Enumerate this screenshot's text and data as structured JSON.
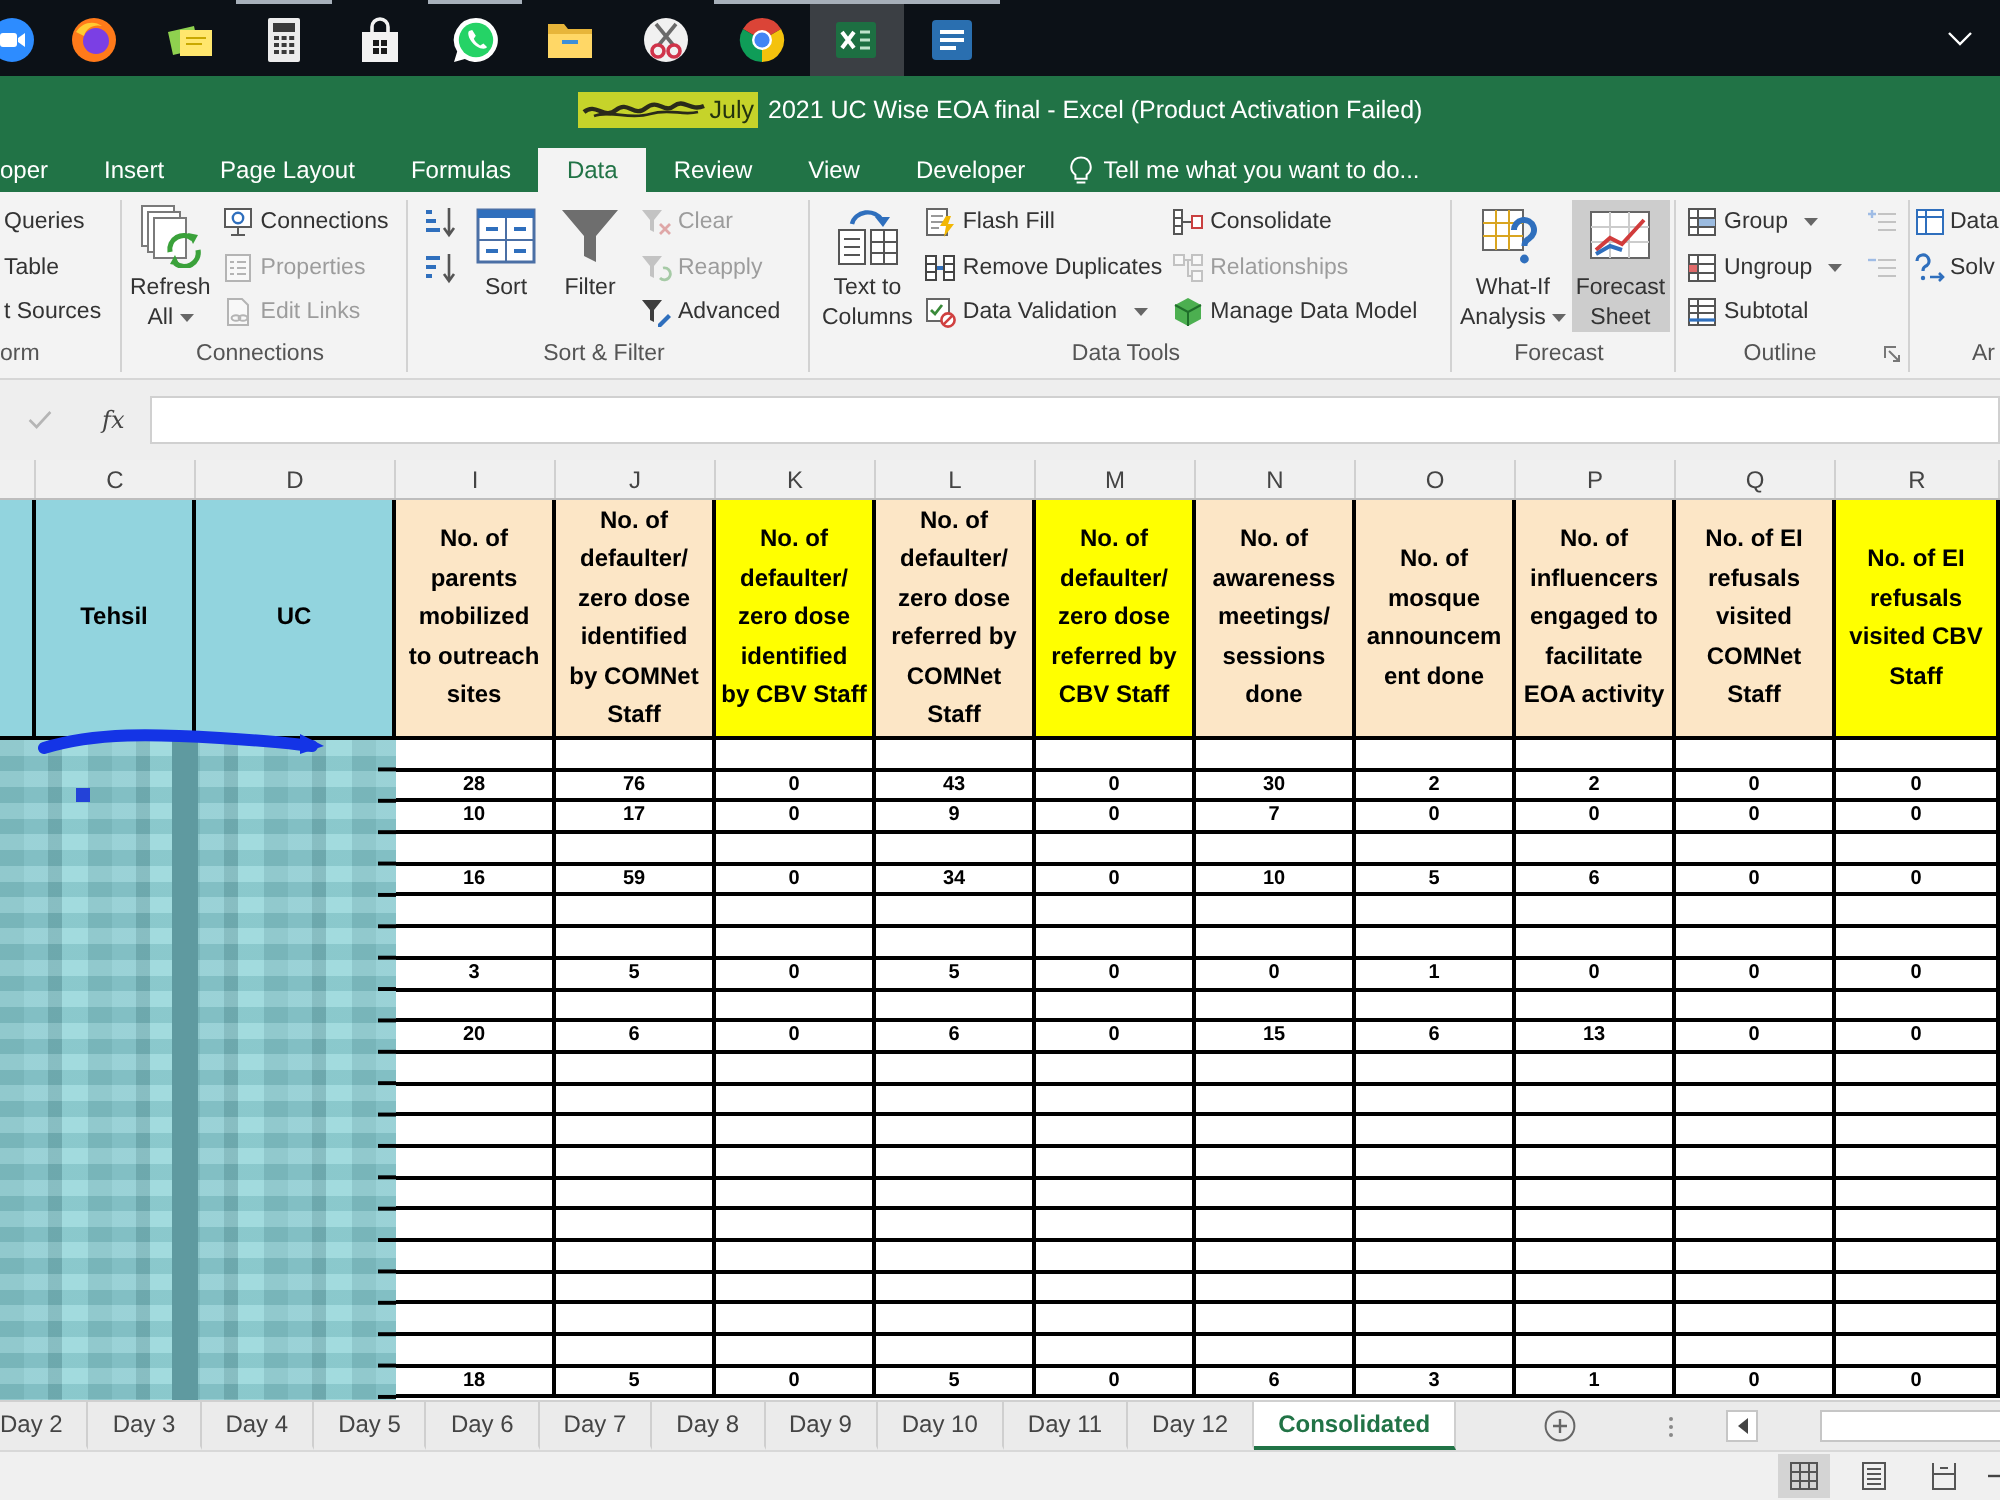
{
  "taskbar": {
    "items": [
      {
        "kind": "video",
        "selected": false,
        "running": false
      },
      {
        "kind": "globe",
        "selected": false,
        "running": false
      },
      {
        "kind": "notes",
        "selected": false,
        "running": false
      },
      {
        "kind": "calculator",
        "selected": false,
        "running": true
      },
      {
        "kind": "store",
        "selected": false,
        "running": false
      },
      {
        "kind": "chat",
        "selected": false,
        "running": true
      },
      {
        "kind": "folder",
        "selected": false,
        "running": false
      },
      {
        "kind": "scissors",
        "selected": false,
        "running": false
      },
      {
        "kind": "browser",
        "selected": false,
        "running": true
      },
      {
        "kind": "spreadsheet",
        "selected": true,
        "running": true
      },
      {
        "kind": "slides",
        "selected": false,
        "running": true
      }
    ]
  },
  "window": {
    "title": {
      "highlighted": "July",
      "text": "2021 UC Wise EOA final - Excel (Product Activation Failed)"
    }
  },
  "ribbon_tabs": [
    {
      "label": "oper",
      "selected": false
    },
    {
      "label": "Insert",
      "selected": false
    },
    {
      "label": "Page Layout",
      "selected": false
    },
    {
      "label": "Formulas",
      "selected": false
    },
    {
      "label": "Data",
      "selected": true
    },
    {
      "label": "Review",
      "selected": false
    },
    {
      "label": "View",
      "selected": false
    },
    {
      "label": "Developer",
      "selected": false
    }
  ],
  "tell_me": {
    "placeholder": "Tell me what you want to do..."
  },
  "ribbon": {
    "groups": [
      {
        "label": "orm",
        "launcher": false,
        "items": [
          {
            "kind": "stack",
            "buttons": [
              {
                "label": "Queries",
                "disabled": false,
                "dropdown": false
              },
              {
                "label": "Table",
                "disabled": false,
                "dropdown": false
              },
              {
                "label": "t Sources",
                "disabled": false,
                "dropdown": false
              }
            ]
          }
        ]
      },
      {
        "label": "Connections",
        "launcher": false,
        "items": [
          {
            "kind": "large",
            "label": "Refresh All",
            "disabled": false,
            "dropdown": true,
            "hovered": false
          },
          {
            "kind": "stack",
            "buttons": [
              {
                "label": "Connections",
                "disabled": false,
                "dropdown": false
              },
              {
                "label": "Properties",
                "disabled": true,
                "dropdown": false
              },
              {
                "label": "Edit Links",
                "disabled": true,
                "dropdown": false
              }
            ]
          }
        ]
      },
      {
        "label": "Sort & Filter",
        "launcher": false,
        "items": [
          {
            "kind": "stack",
            "buttons": [
              {
                "disabled": false,
                "dropdown": false
              },
              {
                "disabled": false,
                "dropdown": false
              }
            ]
          },
          {
            "kind": "large",
            "label": "Sort",
            "disabled": false,
            "dropdown": false,
            "hovered": false
          },
          {
            "kind": "large",
            "label": "Filter",
            "disabled": false,
            "dropdown": false,
            "hovered": false
          },
          {
            "kind": "stack",
            "buttons": [
              {
                "label": "Clear",
                "disabled": true,
                "dropdown": false
              },
              {
                "label": "Reapply",
                "disabled": true,
                "dropdown": false
              },
              {
                "label": "Advanced",
                "disabled": false,
                "dropdown": false
              }
            ]
          }
        ]
      },
      {
        "label": "Data Tools",
        "launcher": false,
        "items": [
          {
            "kind": "large",
            "label": "Text to Columns",
            "disabled": false,
            "dropdown": false,
            "hovered": false
          },
          {
            "kind": "stack",
            "buttons": [
              {
                "label": "Flash Fill",
                "disabled": false,
                "dropdown": false
              },
              {
                "label": "Remove Duplicates",
                "disabled": false,
                "dropdown": false
              },
              {
                "label": "Data Validation",
                "disabled": false,
                "dropdown": true
              }
            ]
          },
          {
            "kind": "stack",
            "buttons": [
              {
                "label": "Consolidate",
                "disabled": false,
                "dropdown": false
              },
              {
                "label": "Relationships",
                "disabled": true,
                "dropdown": false
              },
              {
                "label": "Manage Data Model",
                "disabled": false,
                "dropdown": false
              }
            ]
          }
        ]
      },
      {
        "label": "Forecast",
        "launcher": false,
        "items": [
          {
            "kind": "large",
            "label": "What-If Analysis",
            "disabled": false,
            "dropdown": true,
            "hovered": false
          },
          {
            "kind": "large",
            "label": "Forecast Sheet",
            "disabled": false,
            "dropdown": false,
            "hovered": true
          }
        ]
      },
      {
        "label": "Outline",
        "launcher": true,
        "items": [
          {
            "kind": "stack",
            "buttons": [
              {
                "label": "Group",
                "disabled": false,
                "dropdown": true
              },
              {
                "label": "Ungroup",
                "disabled": false,
                "dropdown": true
              },
              {
                "label": "Subtotal",
                "disabled": false,
                "dropdown": false
              }
            ]
          },
          {
            "kind": "stack",
            "buttons": [
              {
                "disabled": true,
                "dropdown": false
              },
              {
                "disabled": true,
                "dropdown": false
              }
            ]
          }
        ]
      },
      {
        "label": "Ar",
        "launcher": false,
        "items": [
          {
            "kind": "stack",
            "buttons": [
              {
                "label": "Data",
                "disabled": false,
                "dropdown": false
              },
              {
                "label": "Solv",
                "disabled": false,
                "dropdown": false
              }
            ]
          }
        ]
      }
    ]
  },
  "formula_bar": {
    "function_label": "fx"
  },
  "sheet": {
    "columns": [
      "C",
      "D",
      "I",
      "J",
      "K",
      "L",
      "M",
      "N",
      "O",
      "P",
      "Q",
      "R"
    ],
    "header_cells": [
      {
        "color": "#92d4de"
      },
      {
        "text": "Tehsil",
        "color": "#92d4de"
      },
      {
        "text": "UC",
        "color": "#92d4de"
      },
      {
        "text": "No. of\nparents\nmobilized\nto outreach\nsites",
        "color": "#fce6c6"
      },
      {
        "text": "No. of\ndefaulter/\nzero dose\nidentified\nby COMNet\nStaff",
        "color": "#fce6c6"
      },
      {
        "text": "No. of\ndefaulter/\nzero dose\nidentified\nby CBV Staff",
        "color": "#ffff00"
      },
      {
        "text": "No. of\ndefaulter/\nzero dose\nreferred by\nCOMNet\nStaff",
        "color": "#fce6c6"
      },
      {
        "text": "No. of\ndefaulter/\nzero dose\nreferred by\nCBV Staff",
        "color": "#ffff00"
      },
      {
        "text": "No. of\nawareness\nmeetings/\nsessions\ndone",
        "color": "#fce6c6"
      },
      {
        "text": "No. of\nmosque\nannouncem\nent done",
        "color": "#fce6c6"
      },
      {
        "text": "No. of\ninfluencers\nengaged to\nfacilitate\nEOA activity",
        "color": "#fce6c6"
      },
      {
        "text": "No. of EI\nrefusals\nvisited\nCOMNet\nStaff",
        "color": "#fce6c6"
      },
      {
        "text": "No. of EI\nrefusals\nvisited CBV\nStaff",
        "color": "#ffff00"
      }
    ],
    "rows": [
      {
        "kind": "blank"
      },
      {
        "kind": "data",
        "cells": [
          "28",
          "76",
          "0",
          "43",
          "0",
          "30",
          "2",
          "2",
          "0",
          "0"
        ]
      },
      {
        "kind": "data",
        "cells": [
          "10",
          "17",
          "0",
          "9",
          "0",
          "7",
          "0",
          "0",
          "0",
          "0"
        ]
      },
      {
        "kind": "blank"
      },
      {
        "kind": "data",
        "cells": [
          "16",
          "59",
          "0",
          "34",
          "0",
          "10",
          "5",
          "6",
          "0",
          "0"
        ]
      },
      {
        "kind": "blank"
      },
      {
        "kind": "blank"
      },
      {
        "kind": "data",
        "cells": [
          "3",
          "5",
          "0",
          "5",
          "0",
          "0",
          "1",
          "0",
          "0",
          "0"
        ]
      },
      {
        "kind": "blank"
      },
      {
        "kind": "data",
        "cells": [
          "20",
          "6",
          "0",
          "6",
          "0",
          "15",
          "6",
          "13",
          "0",
          "0"
        ]
      },
      {
        "kind": "blank"
      },
      {
        "kind": "blank"
      },
      {
        "kind": "blank"
      },
      {
        "kind": "blank"
      },
      {
        "kind": "blank"
      },
      {
        "kind": "blank"
      },
      {
        "kind": "blank"
      },
      {
        "kind": "blank"
      },
      {
        "kind": "blank"
      },
      {
        "kind": "blank"
      },
      {
        "kind": "data",
        "cells": [
          "18",
          "5",
          "0",
          "5",
          "0",
          "6",
          "3",
          "1",
          "0",
          "0"
        ]
      }
    ]
  },
  "sheet_tabs": [
    {
      "label": "Day 2",
      "selected": false
    },
    {
      "label": "Day 3",
      "selected": false
    },
    {
      "label": "Day 4",
      "selected": false
    },
    {
      "label": "Day 5",
      "selected": false
    },
    {
      "label": "Day 6",
      "selected": false
    },
    {
      "label": "Day 7",
      "selected": false
    },
    {
      "label": "Day 8",
      "selected": false
    },
    {
      "label": "Day 9",
      "selected": false
    },
    {
      "label": "Day 10",
      "selected": false
    },
    {
      "label": "Day 11",
      "selected": false
    },
    {
      "label": "Day 12",
      "selected": false
    },
    {
      "label": "Consolidated",
      "selected": true
    }
  ],
  "status_bar": {
    "views": [
      {
        "selected": true
      },
      {
        "selected": false
      },
      {
        "selected": false
      }
    ]
  }
}
